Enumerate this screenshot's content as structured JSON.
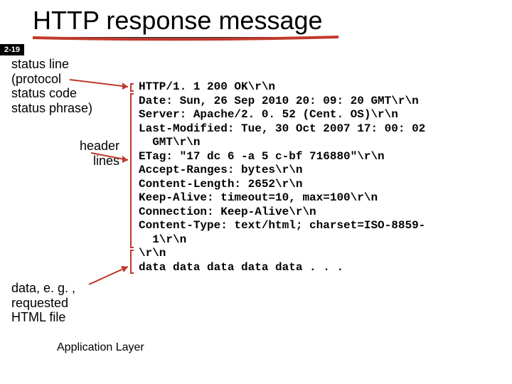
{
  "title": "HTTP response message",
  "slide_label": "2-19",
  "annotations": {
    "status_line": "status line\n(protocol\nstatus code\nstatus phrase)",
    "header_lines": "header\nlines",
    "data_body": "data, e. g. ,\nrequested\nHTML file"
  },
  "code": "HTTP/1. 1 200 OK\\r\\n\nDate: Sun, 26 Sep 2010 20: 09: 20 GMT\\r\\n\nServer: Apache/2. 0. 52 (Cent. OS)\\r\\n\nLast-Modified: Tue, 30 Oct 2007 17: 00: 02\n  GMT\\r\\n\nETag: \"17 dc 6 -a 5 c-bf 716880\"\\r\\n\nAccept-Ranges: bytes\\r\\n\nContent-Length: 2652\\r\\n\nKeep-Alive: timeout=10, max=100\\r\\n\nConnection: Keep-Alive\\r\\n\nContent-Type: text/html; charset=ISO-8859-\n  1\\r\\n\n\\r\\n\ndata data data data data . . .",
  "footer": "Application Layer",
  "colors": {
    "accent": "#c0392b",
    "bracket": "#c0392b"
  }
}
